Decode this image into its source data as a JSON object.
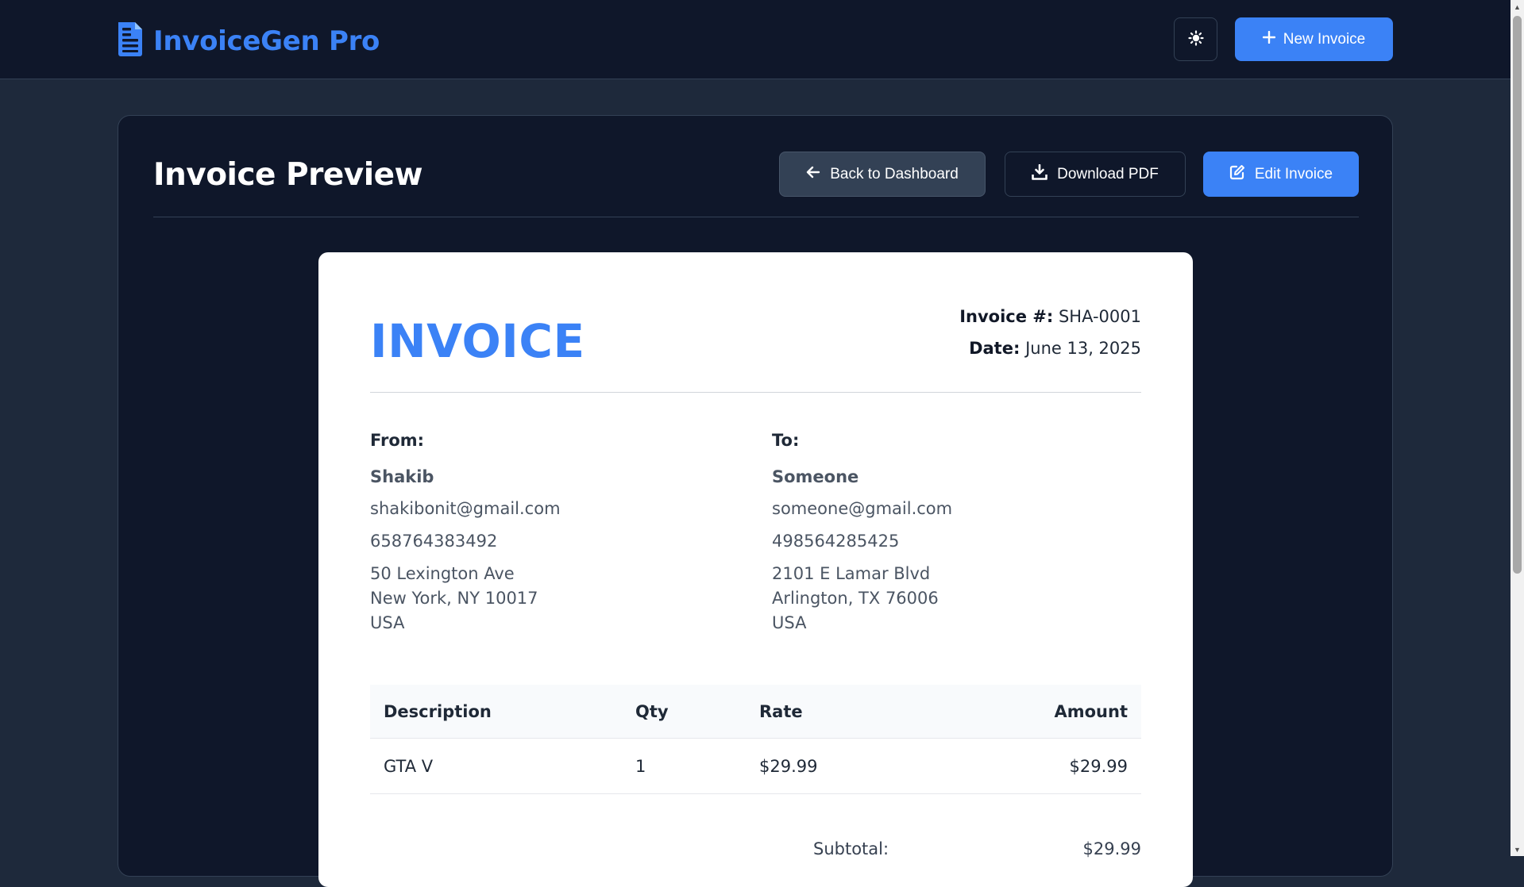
{
  "app": {
    "name": "InvoiceGen Pro",
    "new_invoice_label": "New Invoice",
    "accent_color": "#3b82f6"
  },
  "page": {
    "title": "Invoice Preview",
    "back_label": "Back to Dashboard",
    "download_label": "Download PDF",
    "edit_label": "Edit Invoice"
  },
  "invoice": {
    "heading": "INVOICE",
    "number_label": "Invoice #:",
    "number": "SHA-0001",
    "date_label": "Date:",
    "date": "June 13, 2025",
    "from": {
      "label": "From:",
      "name": "Shakib",
      "email": "shakibonit@gmail.com",
      "phone": "658764383492",
      "address_line1": "50 Lexington Ave",
      "address_line2": "New York, NY 10017",
      "country": "USA"
    },
    "to": {
      "label": "To:",
      "name": "Someone",
      "email": "someone@gmail.com",
      "phone": "498564285425",
      "address_line1": "2101 E Lamar Blvd",
      "address_line2": "Arlington, TX 76006",
      "country": "USA"
    },
    "table": {
      "headers": {
        "description": "Description",
        "qty": "Qty",
        "rate": "Rate",
        "amount": "Amount"
      },
      "rows": [
        {
          "description": "GTA V",
          "qty": "1",
          "rate": "$29.99",
          "amount": "$29.99"
        }
      ]
    },
    "subtotal_label": "Subtotal:",
    "subtotal": "$29.99"
  },
  "icons": {
    "brand": "file-invoice-icon",
    "theme": "sun-icon",
    "new": "plus-icon",
    "back": "arrow-left-icon",
    "download": "download-icon",
    "edit": "edit-icon"
  }
}
